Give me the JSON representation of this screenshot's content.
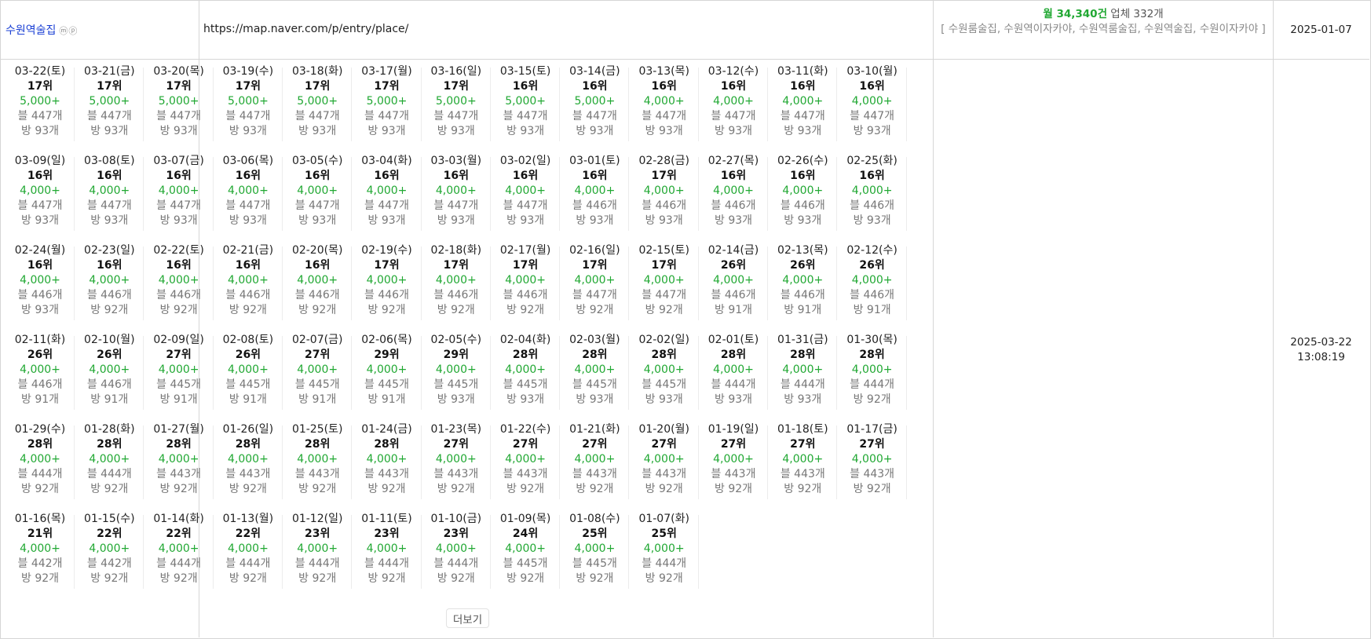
{
  "place": {
    "name": "수원역술집",
    "marks": "ⓜⓟ",
    "url": "https://map.naver.com/p/entry/place/",
    "summary": {
      "monthly": "월 34,340건",
      "businesses": "업체 332개",
      "keywords": "[ 수원룸술집, 수원역이자카야, 수원역룸술집, 수원역술집, 수원이자카야 ]"
    },
    "reg_date": "2025-01-07",
    "updated_date": "2025-03-22",
    "updated_time": "13:08:19"
  },
  "more_label": "더보기",
  "ranks": [
    {
      "date": "03-22(토)",
      "rank": "17위",
      "volume": "5,000+",
      "blog": "블 447개",
      "visit": "방 93개"
    },
    {
      "date": "03-21(금)",
      "rank": "17위",
      "volume": "5,000+",
      "blog": "블 447개",
      "visit": "방 93개"
    },
    {
      "date": "03-20(목)",
      "rank": "17위",
      "volume": "5,000+",
      "blog": "블 447개",
      "visit": "방 93개"
    },
    {
      "date": "03-19(수)",
      "rank": "17위",
      "volume": "5,000+",
      "blog": "블 447개",
      "visit": "방 93개"
    },
    {
      "date": "03-18(화)",
      "rank": "17위",
      "volume": "5,000+",
      "blog": "블 447개",
      "visit": "방 93개"
    },
    {
      "date": "03-17(월)",
      "rank": "17위",
      "volume": "5,000+",
      "blog": "블 447개",
      "visit": "방 93개"
    },
    {
      "date": "03-16(일)",
      "rank": "17위",
      "volume": "5,000+",
      "blog": "블 447개",
      "visit": "방 93개"
    },
    {
      "date": "03-15(토)",
      "rank": "16위",
      "volume": "5,000+",
      "blog": "블 447개",
      "visit": "방 93개"
    },
    {
      "date": "03-14(금)",
      "rank": "16위",
      "volume": "5,000+",
      "blog": "블 447개",
      "visit": "방 93개"
    },
    {
      "date": "03-13(목)",
      "rank": "16위",
      "volume": "4,000+",
      "blog": "블 447개",
      "visit": "방 93개"
    },
    {
      "date": "03-12(수)",
      "rank": "16위",
      "volume": "4,000+",
      "blog": "블 447개",
      "visit": "방 93개"
    },
    {
      "date": "03-11(화)",
      "rank": "16위",
      "volume": "4,000+",
      "blog": "블 447개",
      "visit": "방 93개"
    },
    {
      "date": "03-10(월)",
      "rank": "16위",
      "volume": "4,000+",
      "blog": "블 447개",
      "visit": "방 93개"
    },
    {
      "date": "03-09(일)",
      "rank": "16위",
      "volume": "4,000+",
      "blog": "블 447개",
      "visit": "방 93개"
    },
    {
      "date": "03-08(토)",
      "rank": "16위",
      "volume": "4,000+",
      "blog": "블 447개",
      "visit": "방 93개"
    },
    {
      "date": "03-07(금)",
      "rank": "16위",
      "volume": "4,000+",
      "blog": "블 447개",
      "visit": "방 93개"
    },
    {
      "date": "03-06(목)",
      "rank": "16위",
      "volume": "4,000+",
      "blog": "블 447개",
      "visit": "방 93개"
    },
    {
      "date": "03-05(수)",
      "rank": "16위",
      "volume": "4,000+",
      "blog": "블 447개",
      "visit": "방 93개"
    },
    {
      "date": "03-04(화)",
      "rank": "16위",
      "volume": "4,000+",
      "blog": "블 447개",
      "visit": "방 93개"
    },
    {
      "date": "03-03(월)",
      "rank": "16위",
      "volume": "4,000+",
      "blog": "블 447개",
      "visit": "방 93개"
    },
    {
      "date": "03-02(일)",
      "rank": "16위",
      "volume": "4,000+",
      "blog": "블 447개",
      "visit": "방 93개"
    },
    {
      "date": "03-01(토)",
      "rank": "16위",
      "volume": "4,000+",
      "blog": "블 446개",
      "visit": "방 93개"
    },
    {
      "date": "02-28(금)",
      "rank": "17위",
      "volume": "4,000+",
      "blog": "블 446개",
      "visit": "방 93개"
    },
    {
      "date": "02-27(목)",
      "rank": "16위",
      "volume": "4,000+",
      "blog": "블 446개",
      "visit": "방 93개"
    },
    {
      "date": "02-26(수)",
      "rank": "16위",
      "volume": "4,000+",
      "blog": "블 446개",
      "visit": "방 93개"
    },
    {
      "date": "02-25(화)",
      "rank": "16위",
      "volume": "4,000+",
      "blog": "블 446개",
      "visit": "방 93개"
    },
    {
      "date": "02-24(월)",
      "rank": "16위",
      "volume": "4,000+",
      "blog": "블 446개",
      "visit": "방 93개"
    },
    {
      "date": "02-23(일)",
      "rank": "16위",
      "volume": "4,000+",
      "blog": "블 446개",
      "visit": "방 92개"
    },
    {
      "date": "02-22(토)",
      "rank": "16위",
      "volume": "4,000+",
      "blog": "블 446개",
      "visit": "방 92개"
    },
    {
      "date": "02-21(금)",
      "rank": "16위",
      "volume": "4,000+",
      "blog": "블 446개",
      "visit": "방 92개"
    },
    {
      "date": "02-20(목)",
      "rank": "16위",
      "volume": "4,000+",
      "blog": "블 446개",
      "visit": "방 92개"
    },
    {
      "date": "02-19(수)",
      "rank": "17위",
      "volume": "4,000+",
      "blog": "블 446개",
      "visit": "방 92개"
    },
    {
      "date": "02-18(화)",
      "rank": "17위",
      "volume": "4,000+",
      "blog": "블 446개",
      "visit": "방 92개"
    },
    {
      "date": "02-17(월)",
      "rank": "17위",
      "volume": "4,000+",
      "blog": "블 446개",
      "visit": "방 92개"
    },
    {
      "date": "02-16(일)",
      "rank": "17위",
      "volume": "4,000+",
      "blog": "블 447개",
      "visit": "방 92개"
    },
    {
      "date": "02-15(토)",
      "rank": "17위",
      "volume": "4,000+",
      "blog": "블 447개",
      "visit": "방 92개"
    },
    {
      "date": "02-14(금)",
      "rank": "26위",
      "volume": "4,000+",
      "blog": "블 446개",
      "visit": "방 91개"
    },
    {
      "date": "02-13(목)",
      "rank": "26위",
      "volume": "4,000+",
      "blog": "블 446개",
      "visit": "방 91개"
    },
    {
      "date": "02-12(수)",
      "rank": "26위",
      "volume": "4,000+",
      "blog": "블 446개",
      "visit": "방 91개"
    },
    {
      "date": "02-11(화)",
      "rank": "26위",
      "volume": "4,000+",
      "blog": "블 446개",
      "visit": "방 91개"
    },
    {
      "date": "02-10(월)",
      "rank": "26위",
      "volume": "4,000+",
      "blog": "블 446개",
      "visit": "방 91개"
    },
    {
      "date": "02-09(일)",
      "rank": "27위",
      "volume": "4,000+",
      "blog": "블 445개",
      "visit": "방 91개"
    },
    {
      "date": "02-08(토)",
      "rank": "26위",
      "volume": "4,000+",
      "blog": "블 445개",
      "visit": "방 91개"
    },
    {
      "date": "02-07(금)",
      "rank": "27위",
      "volume": "4,000+",
      "blog": "블 445개",
      "visit": "방 91개"
    },
    {
      "date": "02-06(목)",
      "rank": "29위",
      "volume": "4,000+",
      "blog": "블 445개",
      "visit": "방 91개"
    },
    {
      "date": "02-05(수)",
      "rank": "29위",
      "volume": "4,000+",
      "blog": "블 445개",
      "visit": "방 93개"
    },
    {
      "date": "02-04(화)",
      "rank": "28위",
      "volume": "4,000+",
      "blog": "블 445개",
      "visit": "방 93개"
    },
    {
      "date": "02-03(월)",
      "rank": "28위",
      "volume": "4,000+",
      "blog": "블 445개",
      "visit": "방 93개"
    },
    {
      "date": "02-02(일)",
      "rank": "28위",
      "volume": "4,000+",
      "blog": "블 445개",
      "visit": "방 93개"
    },
    {
      "date": "02-01(토)",
      "rank": "28위",
      "volume": "4,000+",
      "blog": "블 444개",
      "visit": "방 93개"
    },
    {
      "date": "01-31(금)",
      "rank": "28위",
      "volume": "4,000+",
      "blog": "블 444개",
      "visit": "방 93개"
    },
    {
      "date": "01-30(목)",
      "rank": "28위",
      "volume": "4,000+",
      "blog": "블 444개",
      "visit": "방 92개"
    },
    {
      "date": "01-29(수)",
      "rank": "28위",
      "volume": "4,000+",
      "blog": "블 444개",
      "visit": "방 92개"
    },
    {
      "date": "01-28(화)",
      "rank": "28위",
      "volume": "4,000+",
      "blog": "블 444개",
      "visit": "방 92개"
    },
    {
      "date": "01-27(월)",
      "rank": "28위",
      "volume": "4,000+",
      "blog": "블 443개",
      "visit": "방 92개"
    },
    {
      "date": "01-26(일)",
      "rank": "28위",
      "volume": "4,000+",
      "blog": "블 443개",
      "visit": "방 92개"
    },
    {
      "date": "01-25(토)",
      "rank": "28위",
      "volume": "4,000+",
      "blog": "블 443개",
      "visit": "방 92개"
    },
    {
      "date": "01-24(금)",
      "rank": "28위",
      "volume": "4,000+",
      "blog": "블 443개",
      "visit": "방 92개"
    },
    {
      "date": "01-23(목)",
      "rank": "27위",
      "volume": "4,000+",
      "blog": "블 443개",
      "visit": "방 92개"
    },
    {
      "date": "01-22(수)",
      "rank": "27위",
      "volume": "4,000+",
      "blog": "블 443개",
      "visit": "방 92개"
    },
    {
      "date": "01-21(화)",
      "rank": "27위",
      "volume": "4,000+",
      "blog": "블 443개",
      "visit": "방 92개"
    },
    {
      "date": "01-20(월)",
      "rank": "27위",
      "volume": "4,000+",
      "blog": "블 443개",
      "visit": "방 92개"
    },
    {
      "date": "01-19(일)",
      "rank": "27위",
      "volume": "4,000+",
      "blog": "블 443개",
      "visit": "방 92개"
    },
    {
      "date": "01-18(토)",
      "rank": "27위",
      "volume": "4,000+",
      "blog": "블 443개",
      "visit": "방 92개"
    },
    {
      "date": "01-17(금)",
      "rank": "27위",
      "volume": "4,000+",
      "blog": "블 443개",
      "visit": "방 92개"
    },
    {
      "date": "01-16(목)",
      "rank": "21위",
      "volume": "4,000+",
      "blog": "블 442개",
      "visit": "방 92개"
    },
    {
      "date": "01-15(수)",
      "rank": "22위",
      "volume": "4,000+",
      "blog": "블 442개",
      "visit": "방 92개"
    },
    {
      "date": "01-14(화)",
      "rank": "22위",
      "volume": "4,000+",
      "blog": "블 444개",
      "visit": "방 92개"
    },
    {
      "date": "01-13(월)",
      "rank": "22위",
      "volume": "4,000+",
      "blog": "블 444개",
      "visit": "방 92개"
    },
    {
      "date": "01-12(일)",
      "rank": "23위",
      "volume": "4,000+",
      "blog": "블 444개",
      "visit": "방 92개"
    },
    {
      "date": "01-11(토)",
      "rank": "23위",
      "volume": "4,000+",
      "blog": "블 444개",
      "visit": "방 92개"
    },
    {
      "date": "01-10(금)",
      "rank": "23위",
      "volume": "4,000+",
      "blog": "블 444개",
      "visit": "방 92개"
    },
    {
      "date": "01-09(목)",
      "rank": "24위",
      "volume": "4,000+",
      "blog": "블 445개",
      "visit": "방 92개"
    },
    {
      "date": "01-08(수)",
      "rank": "25위",
      "volume": "4,000+",
      "blog": "블 445개",
      "visit": "방 92개"
    },
    {
      "date": "01-07(화)",
      "rank": "25위",
      "volume": "4,000+",
      "blog": "블 444개",
      "visit": "방 92개"
    }
  ]
}
